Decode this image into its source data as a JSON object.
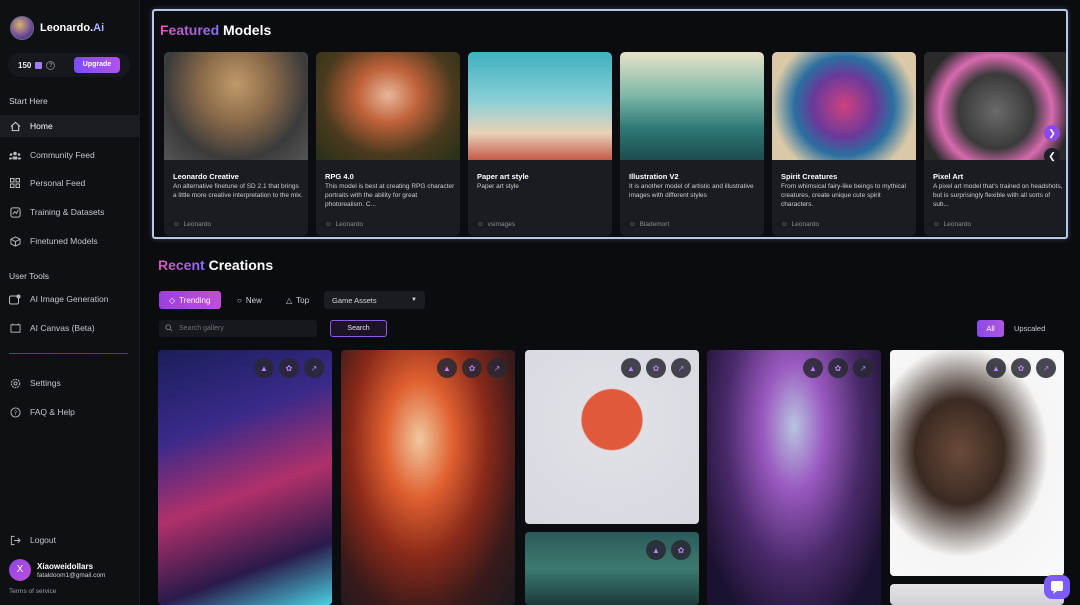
{
  "brand": {
    "name_part1": "Leonardo.",
    "name_part2": "Ai"
  },
  "tokens": {
    "count": "150",
    "upgrade_label": "Upgrade"
  },
  "sidebar": {
    "start_here_label": "Start Here",
    "start_items": [
      {
        "label": "Home",
        "icon": "home-icon"
      },
      {
        "label": "Community Feed",
        "icon": "community-icon"
      },
      {
        "label": "Personal Feed",
        "icon": "grid-icon"
      },
      {
        "label": "Training & Datasets",
        "icon": "training-icon"
      },
      {
        "label": "Finetuned Models",
        "icon": "cube-icon"
      }
    ],
    "user_tools_label": "User Tools",
    "tool_items": [
      {
        "label": "AI Image Generation",
        "icon": "image-gen-icon"
      },
      {
        "label": "AI Canvas (Beta)",
        "icon": "canvas-icon"
      }
    ],
    "bottom_items": [
      {
        "label": "Settings",
        "icon": "gear-icon"
      },
      {
        "label": "FAQ & Help",
        "icon": "help-icon"
      }
    ],
    "logout_label": "Logout",
    "user": {
      "avatar_letter": "X",
      "name": "Xiaoweidollars",
      "email": "fataldoom1@gmail.com"
    },
    "terms_label": "Terms of service"
  },
  "featured": {
    "title_accent": "Featured",
    "title_rest": " Models",
    "cards": [
      {
        "title": "Leonardo Creative",
        "desc": "An alternative finetune of SD 2.1 that brings a little more creative interpretation to the mix.",
        "author": "Leonardo"
      },
      {
        "title": "RPG 4.0",
        "desc": "This model is best at creating RPG character portraits with the ability for great photorealism. C...",
        "author": "Leonardo"
      },
      {
        "title": "Paper art style",
        "desc": "Paper art style",
        "author": "vsimages"
      },
      {
        "title": "Illustration V2",
        "desc": "It is another model of artistic and illustrative images with different styles",
        "author": "Blademort"
      },
      {
        "title": "Spirit Creatures",
        "desc": "From whimsical fairy-like beings to mythical creatures, create unique cute spirit characters.",
        "author": "Leonardo"
      },
      {
        "title": "Pixel Art",
        "desc": "A pixel art model that's trained on headshots, but is surprisingly flexible with all sorts of sub...",
        "author": "Leonardo"
      }
    ]
  },
  "recent": {
    "title_accent": "Recent",
    "title_rest": " Creations",
    "tabs": [
      "Trending",
      "New",
      "Top"
    ],
    "dropdown_value": "Game Assets",
    "search_placeholder": "Search gallery",
    "search_button": "Search",
    "filter_all": "All",
    "filter_upscaled": "Upscaled"
  },
  "colors": {
    "accent": "#8b4ae8",
    "bg": "#0b0c10",
    "sidebar_bg": "#0f1014"
  }
}
